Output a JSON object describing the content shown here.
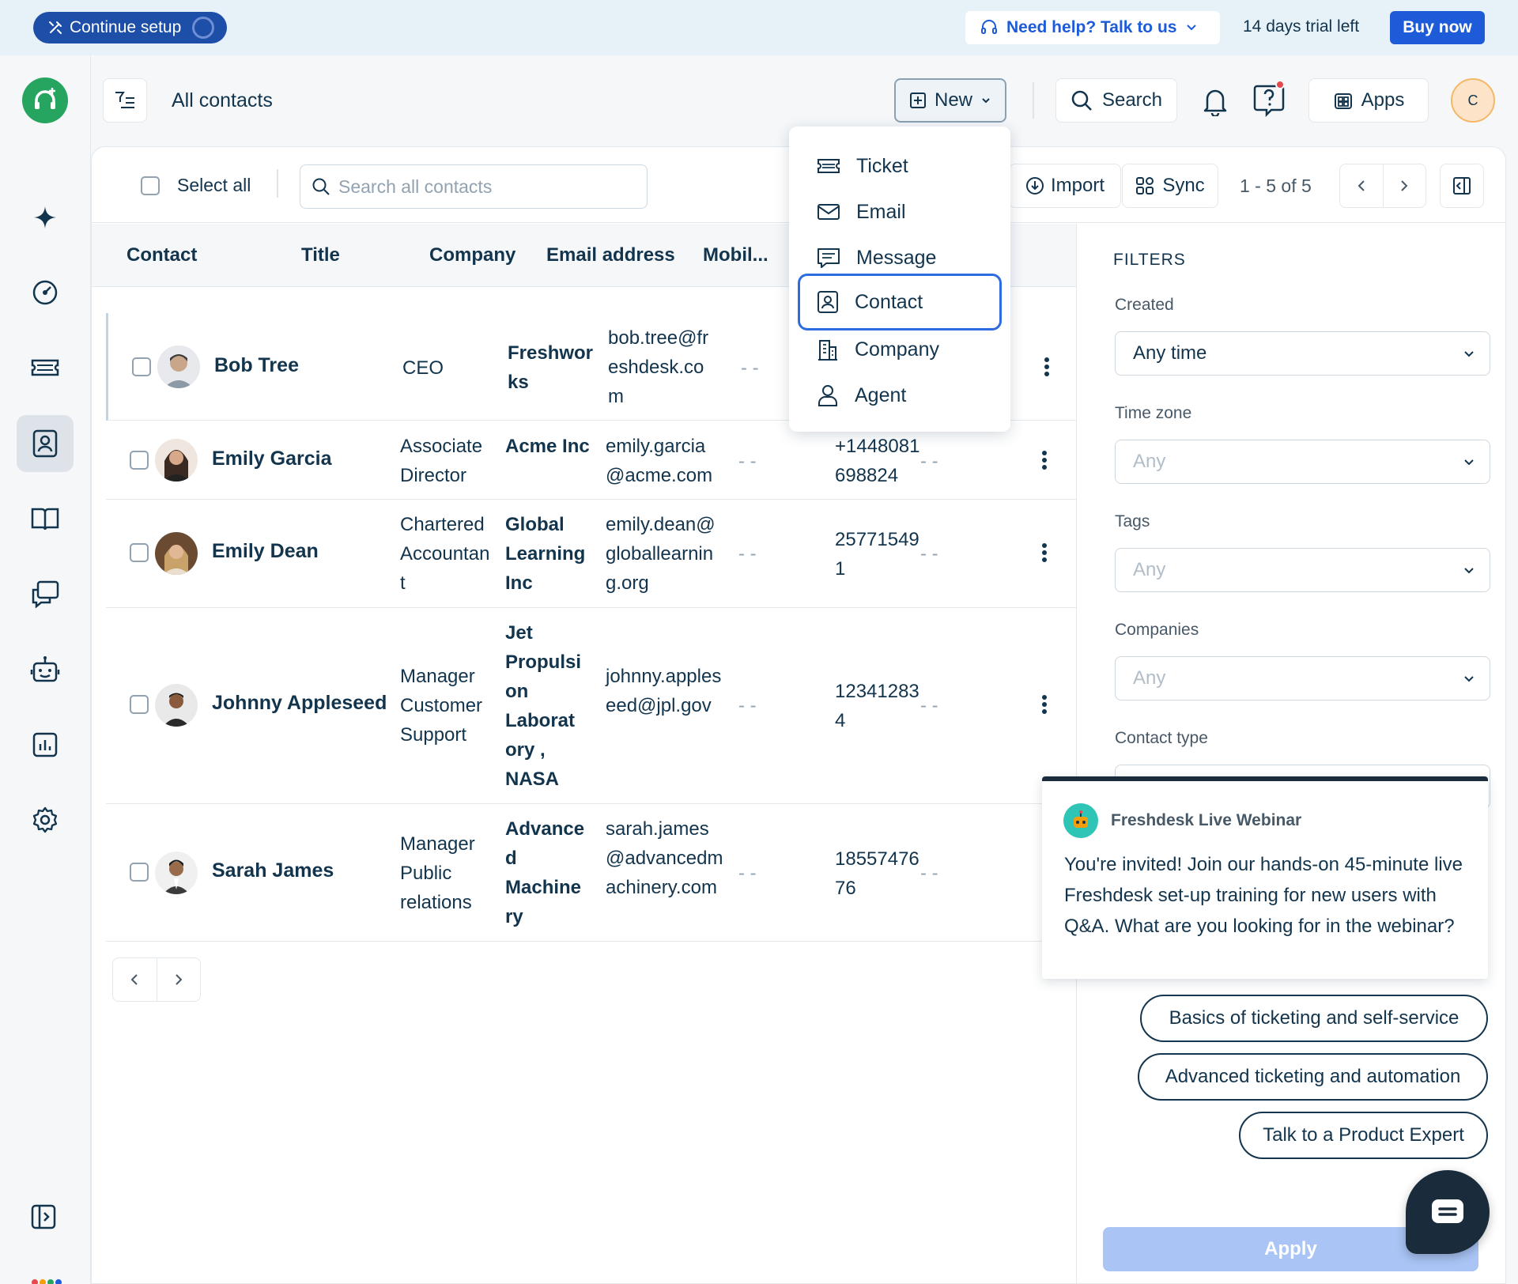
{
  "topbar": {
    "setup_label": "Continue setup",
    "help_label": "Need help? Talk to us",
    "trial_text": "14 days trial left",
    "buy_label": "Buy now"
  },
  "sidebar": {
    "items": [
      {
        "name": "freddy-ai-icon"
      },
      {
        "name": "dashboard-icon"
      },
      {
        "name": "tickets-icon"
      },
      {
        "name": "contacts-icon",
        "active": true
      },
      {
        "name": "solutions-icon"
      },
      {
        "name": "discussions-icon"
      },
      {
        "name": "bot-icon"
      },
      {
        "name": "reports-icon"
      },
      {
        "name": "settings-icon"
      }
    ]
  },
  "header": {
    "title": "All contacts",
    "new_label": "New",
    "search_label": "Search",
    "apps_label": "Apps",
    "avatar_initial": "C"
  },
  "toolbar": {
    "select_all_label": "Select all",
    "search_placeholder": "Search all contacts",
    "import_label": "Import",
    "sync_label": "Sync",
    "pager_text": "1 - 5 of 5"
  },
  "table": {
    "columns": [
      "Contact",
      "Title",
      "Company",
      "Email address",
      "Mobil..."
    ],
    "rows": [
      {
        "name": "Bob Tree",
        "title": "CEO",
        "company": "Freshworks",
        "email": "bob.tree@freshdesk.com",
        "dash": "- -",
        "mobile": "",
        "dash2": ""
      },
      {
        "name": "Emily Garcia",
        "title": "Associate Director",
        "company": "Acme Inc",
        "email": "emily.garcia@acme.com",
        "dash": "- -",
        "mobile": "+1448081698824",
        "dash2": "- -"
      },
      {
        "name": "Emily Dean",
        "title": "Chartered Accountant",
        "company": "Global Learning Inc",
        "email": "emily.dean@globallearning.org",
        "dash": "- -",
        "mobile": "257715491",
        "dash2": "- -"
      },
      {
        "name": "Johnny Appleseed",
        "title": "Manager Customer Support",
        "company": "Jet Propulsion Laboratory , NASA",
        "email": "johnny.appleseed@jpl.gov",
        "dash": "- -",
        "mobile": "123412834",
        "dash2": "- -"
      },
      {
        "name": "Sarah James",
        "title": "Manager Public relations",
        "company": "Advanced Machinery",
        "email": "sarah.james@advancedmachinery.com",
        "dash": "- -",
        "mobile": "1855747676",
        "dash2": "- -"
      }
    ]
  },
  "new_menu": {
    "items": [
      {
        "label": "Ticket",
        "icon": "ticket-icon"
      },
      {
        "label": "Email",
        "icon": "email-icon"
      },
      {
        "label": "Message",
        "icon": "message-icon"
      },
      {
        "label": "Contact",
        "icon": "contact-icon",
        "selected": true
      },
      {
        "label": "Company",
        "icon": "company-icon"
      },
      {
        "label": "Agent",
        "icon": "agent-icon"
      }
    ]
  },
  "filters": {
    "title": "FILTERS",
    "fields": [
      {
        "label": "Created",
        "value": "Any time"
      },
      {
        "label": "Time zone",
        "value": "Any"
      },
      {
        "label": "Tags",
        "value": "Any"
      },
      {
        "label": "Companies",
        "value": "Any"
      },
      {
        "label": "Contact type",
        "value": ""
      }
    ],
    "apply_label": "Apply"
  },
  "webinar": {
    "sender": "Freshdesk Live Webinar",
    "message": "You're invited! Join our hands-on 45-minute live Freshdesk set-up training for new users with Q&A. What are you looking for in the webinar?",
    "options": [
      "Basics of ticketing and self-service",
      "Advanced ticketing and automation",
      "Talk to a Product Expert"
    ]
  },
  "colors": {
    "brand_blue": "#1d5bd8",
    "setup_blue": "#1d4ea8",
    "logo_green": "#25a55f",
    "text_dark": "#12344d",
    "apply_disabled": "#a9c4f5"
  }
}
